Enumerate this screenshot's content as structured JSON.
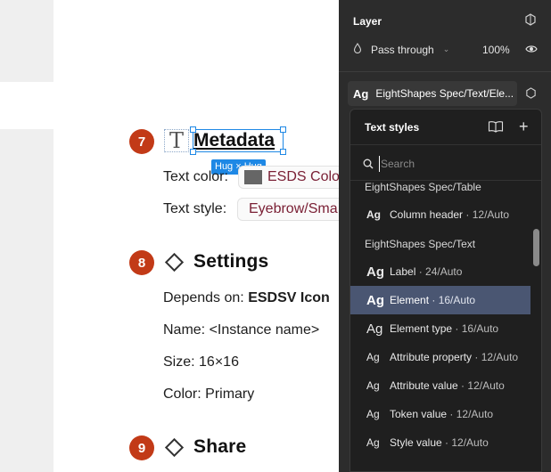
{
  "canvas": {
    "sections": [
      {
        "number": "7",
        "heading": "Metadata"
      },
      {
        "number": "8",
        "heading": "Settings"
      },
      {
        "number": "9",
        "heading": "Share"
      }
    ],
    "metadata": {
      "text_color_label": "Text color:",
      "text_color_value": "ESDS Colo",
      "text_style_label": "Text style:",
      "text_style_value": "Eyebrow/Sma",
      "size_tag": "Hug × Hug"
    },
    "settings": {
      "depends_label": "Depends on:",
      "depends_value": "ESDSV Icon",
      "name_label": "Name:",
      "name_value": "<Instance name>",
      "size_label": "Size:",
      "size_value": "16×16",
      "color_label": "Color:",
      "color_value": "Primary"
    }
  },
  "panel": {
    "layer_title": "Layer",
    "blend_mode": "Pass through",
    "opacity": "100%",
    "applied_style": "EightShapes Spec/Text/Ele...",
    "applied_style_glyph": "Ag"
  },
  "popover": {
    "title": "Text styles",
    "search_placeholder": "Search",
    "groups": [
      {
        "label": "EightShapes Spec/Table",
        "items": [
          {
            "glyph": "Ag",
            "name": "Column header",
            "meta": "12/Auto"
          }
        ]
      },
      {
        "label": "EightShapes Spec/Text",
        "items": [
          {
            "glyph": "Ag",
            "name": "Label",
            "meta": "24/Auto"
          },
          {
            "glyph": "Ag",
            "name": "Element",
            "meta": "16/Auto",
            "selected": true
          },
          {
            "glyph": "Ag",
            "name": "Element type",
            "meta": "16/Auto"
          },
          {
            "glyph": "Ag",
            "name": "Attribute property",
            "meta": "12/Auto"
          },
          {
            "glyph": "Ag",
            "name": "Attribute value",
            "meta": "12/Auto"
          },
          {
            "glyph": "Ag",
            "name": "Token value",
            "meta": "12/Auto"
          },
          {
            "glyph": "Ag",
            "name": "Style value",
            "meta": "12/Auto"
          }
        ]
      }
    ]
  },
  "colors": {
    "badge": "#c23a17",
    "selection": "#1e88e5",
    "panel_bg": "#2c2c2c",
    "popover_bg": "#1f1f1f",
    "selected_item": "#4a5672",
    "chip_text": "#7a2035"
  },
  "icons": [
    "component-icon",
    "drop-icon",
    "chevron-down-icon",
    "eye-icon",
    "style-detach-icon",
    "book-icon",
    "plus-icon",
    "search-icon",
    "text-type-icon",
    "diamond-icon"
  ]
}
